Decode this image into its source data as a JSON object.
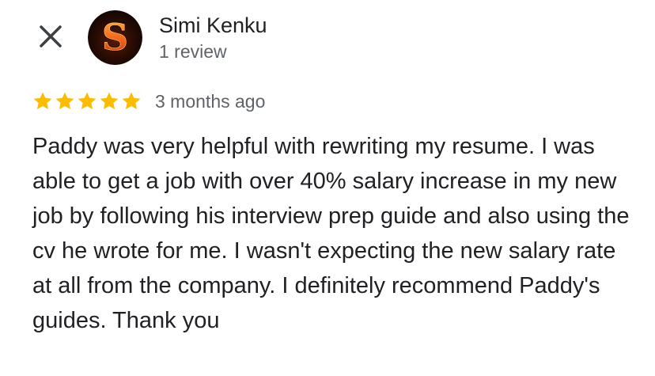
{
  "review": {
    "reviewer_name": "Simi Kenku",
    "review_count": "1 review",
    "avatar_letter": "S",
    "rating": 5,
    "rating_max": 5,
    "timestamp": "3 months ago",
    "text": "Paddy was very helpful with rewriting my resume. I was able to get a job with over 40% salary increase in my new job by following his interview prep guide and also using the cv he wrote for me. I wasn't expecting the new salary rate at all from the company. I definitely recommend Paddy's guides. Thank you"
  },
  "icons": {
    "close": "close-icon",
    "star": "star-icon"
  },
  "colors": {
    "star": "#fbbc04",
    "text_primary": "#202124",
    "text_secondary": "#5f6368",
    "avatar_letter": "#e8531f"
  }
}
